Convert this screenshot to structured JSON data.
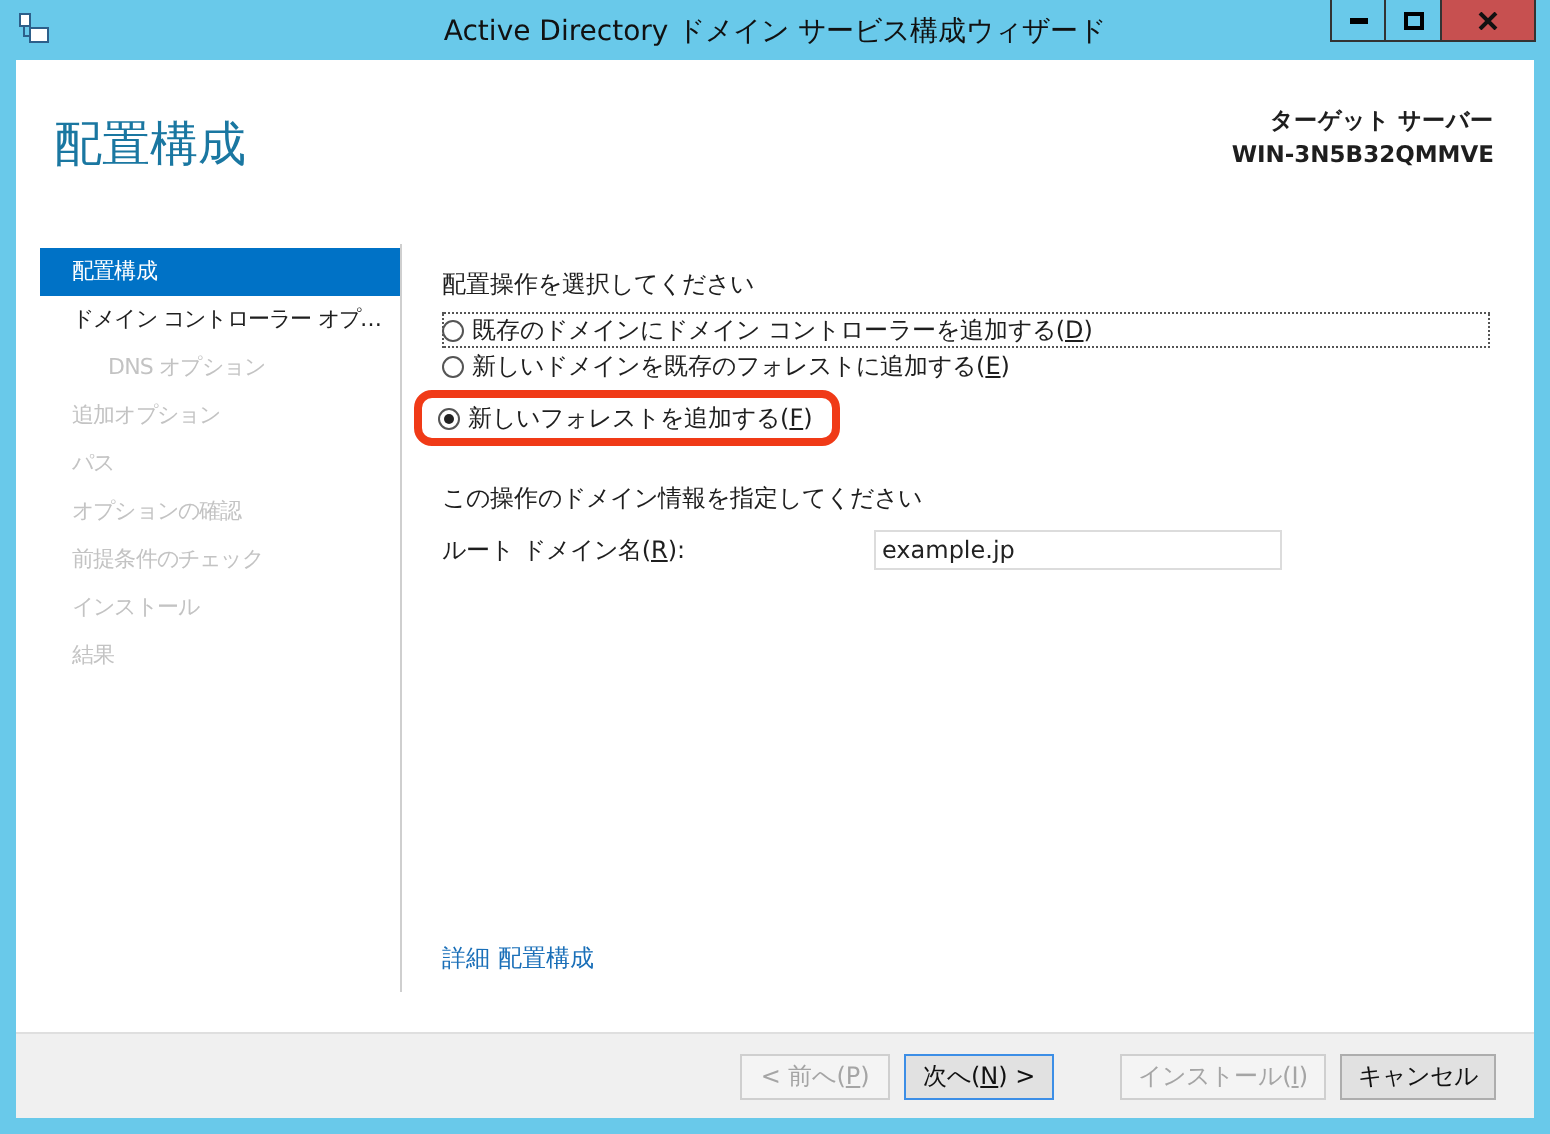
{
  "window": {
    "title": "Active Directory ドメイン サービス構成ウィザード"
  },
  "header": {
    "title": "配置構成",
    "target_label": "ターゲット サーバー",
    "target_server": "WIN-3N5B32QMMVE"
  },
  "sidebar": {
    "items": [
      {
        "label": "配置構成",
        "selected": true,
        "disabled": false
      },
      {
        "label": "ドメイン コントローラー オプ…",
        "selected": false,
        "disabled": false,
        "children": [
          {
            "label": "DNS オプション",
            "selected": false,
            "disabled": true
          }
        ]
      },
      {
        "label": "追加オプション",
        "selected": false,
        "disabled": true
      },
      {
        "label": "パス",
        "selected": false,
        "disabled": true
      },
      {
        "label": "オプションの確認",
        "selected": false,
        "disabled": true
      },
      {
        "label": "前提条件のチェック",
        "selected": false,
        "disabled": true
      },
      {
        "label": "インストール",
        "selected": false,
        "disabled": true
      },
      {
        "label": "結果",
        "selected": false,
        "disabled": true
      }
    ]
  },
  "operation": {
    "heading": "配置操作を選択してください",
    "options": [
      {
        "label": "既存のドメインにドメイン コントローラーを追加する(D)",
        "selected": false,
        "focused": true,
        "highlighted": false
      },
      {
        "label": "新しいドメインを既存のフォレストに追加する(E)",
        "selected": false,
        "focused": false,
        "highlighted": false
      },
      {
        "label": "新しいフォレストを追加する(F)",
        "selected": true,
        "focused": false,
        "highlighted": true
      }
    ]
  },
  "domain_info": {
    "heading": "この操作のドメイン情報を指定してください",
    "field_label": "ルート ドメイン名(R):",
    "value": "example.jp"
  },
  "more_link": "詳細 配置構成",
  "buttons": [
    {
      "label": "< 前へ(P)",
      "disabled": true,
      "default": false
    },
    {
      "label": "次へ(N) >",
      "disabled": false,
      "default": true
    },
    {
      "label": "インストール(I)",
      "disabled": true,
      "default": false
    },
    {
      "label": "キャンセル",
      "disabled": false,
      "default": false
    }
  ]
}
